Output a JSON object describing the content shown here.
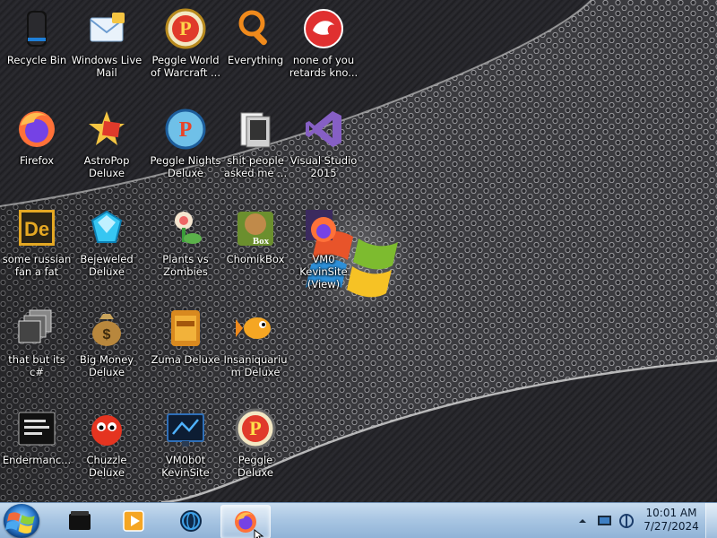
{
  "desktop": {
    "icons": [
      {
        "label": "Recycle Bin",
        "icon": "recycle-bin-icon"
      },
      {
        "label": "Windows Live Mail",
        "icon": "windows-live-mail-icon"
      },
      {
        "label": "Peggle World of Warcraft ...",
        "icon": "peggle-wow-icon"
      },
      {
        "label": "Everything",
        "icon": "everything-search-icon"
      },
      {
        "label": "none of you retards kno...",
        "icon": "red-creature-icon"
      },
      {
        "label": "Firefox",
        "icon": "firefox-icon"
      },
      {
        "label": "AstroPop Deluxe",
        "icon": "astropop-icon"
      },
      {
        "label": "Peggle Nights Deluxe",
        "icon": "peggle-nights-icon"
      },
      {
        "label": "shit people asked me ...",
        "icon": "folder-icon"
      },
      {
        "label": "Visual Studio 2015",
        "icon": "visual-studio-icon"
      },
      {
        "label": "some russian fan a fat",
        "icon": "dreamweaver-icon"
      },
      {
        "label": "Bejeweled Deluxe",
        "icon": "bejeweled-icon"
      },
      {
        "label": "Plants vs Zombies",
        "icon": "plants-vs-zombies-icon"
      },
      {
        "label": "ChomikBox",
        "icon": "chomikbox-icon"
      },
      {
        "label": "VM0 KevinSite (View)",
        "icon": "firefox-shortcut-icon"
      },
      {
        "label": "that but its c#",
        "icon": "stacked-windows-icon"
      },
      {
        "label": "Big Money Deluxe",
        "icon": "money-bag-icon"
      },
      {
        "label": "Zuma Deluxe",
        "icon": "zuma-icon"
      },
      {
        "label": "Insaniquarium Deluxe",
        "icon": "goldfish-icon"
      },
      {
        "label": "Endermanc...",
        "icon": "terminal-icon"
      },
      {
        "label": "Chuzzle Deluxe",
        "icon": "chuzzle-icon"
      },
      {
        "label": "VM0b0t KevinSite",
        "icon": "monitor-app-icon"
      },
      {
        "label": "Peggle Deluxe",
        "icon": "peggle-icon"
      }
    ]
  },
  "taskbar": {
    "start": "start-orb-icon",
    "apps": [
      {
        "name": "terminal-taskbar-icon",
        "active": false
      },
      {
        "name": "media-player-taskbar-icon",
        "active": false
      },
      {
        "name": "globe-taskbar-icon",
        "active": false
      },
      {
        "name": "firefox-taskbar-icon",
        "active": true
      }
    ],
    "tray": {
      "icons": [
        "show-hidden-icons-chevron-icon",
        "action-center-flag-icon",
        "network-icon"
      ],
      "time": "10:01 AM",
      "date": "7/27/2024"
    }
  },
  "colors": {
    "taskbar_top": "#c7dcef",
    "taskbar_bottom": "#8fb2d6",
    "wallpaper_dark": "#1c1c20",
    "wallpaper_mesh": "#8a8a8a"
  }
}
